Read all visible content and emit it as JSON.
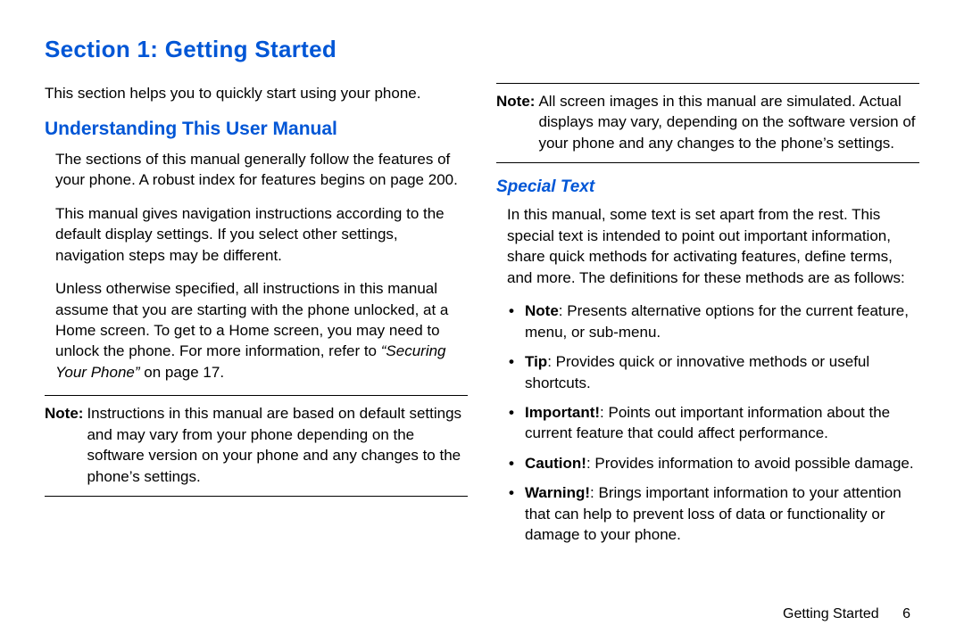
{
  "section_title": "Section 1: Getting Started",
  "intro": "This section helps you to quickly start using your phone.",
  "understanding": {
    "heading": "Understanding This User Manual",
    "p1": "The sections of this manual generally follow the features of your phone. A robust index for features begins on page 200.",
    "p2": "This manual gives navigation instructions according to the default display settings. If you select other settings, navigation steps may be different.",
    "p3a": "Unless otherwise specified, all instructions in this manual assume that you are starting with the phone unlocked, at a Home screen. To get to a Home screen, you may need to unlock the phone. For more information, refer to ",
    "p3_ref": "“Securing Your Phone”",
    "p3b": " on page 17.",
    "note1_label": "Note:",
    "note1_body": "Instructions in this manual are based on default settings and may vary from your phone depending on the software version on your phone and any changes to the phone’s settings."
  },
  "note2": {
    "label": "Note:",
    "body": "All screen images in this manual are simulated. Actual displays may vary, depending on the software version of your phone and any changes to the phone’s settings."
  },
  "special_text": {
    "heading": "Special Text",
    "intro": "In this manual, some text is set apart from the rest. This special text is intended to point out important information, share quick methods for activating features, define terms, and more. The definitions for these methods are as follows:",
    "items": [
      {
        "term": "Note",
        "desc": ": Presents alternative options for the current feature, menu, or sub-menu."
      },
      {
        "term": "Tip",
        "desc": ": Provides quick or innovative methods or useful shortcuts."
      },
      {
        "term": "Important!",
        "desc": ": Points out important information about the current feature that could affect performance."
      },
      {
        "term": "Caution!",
        "desc": ": Provides information to avoid possible damage."
      },
      {
        "term": "Warning!",
        "desc": ": Brings important information to your attention that can help to prevent loss of data or functionality or damage to your phone."
      }
    ]
  },
  "footer": {
    "label": "Getting Started",
    "page": "6"
  }
}
